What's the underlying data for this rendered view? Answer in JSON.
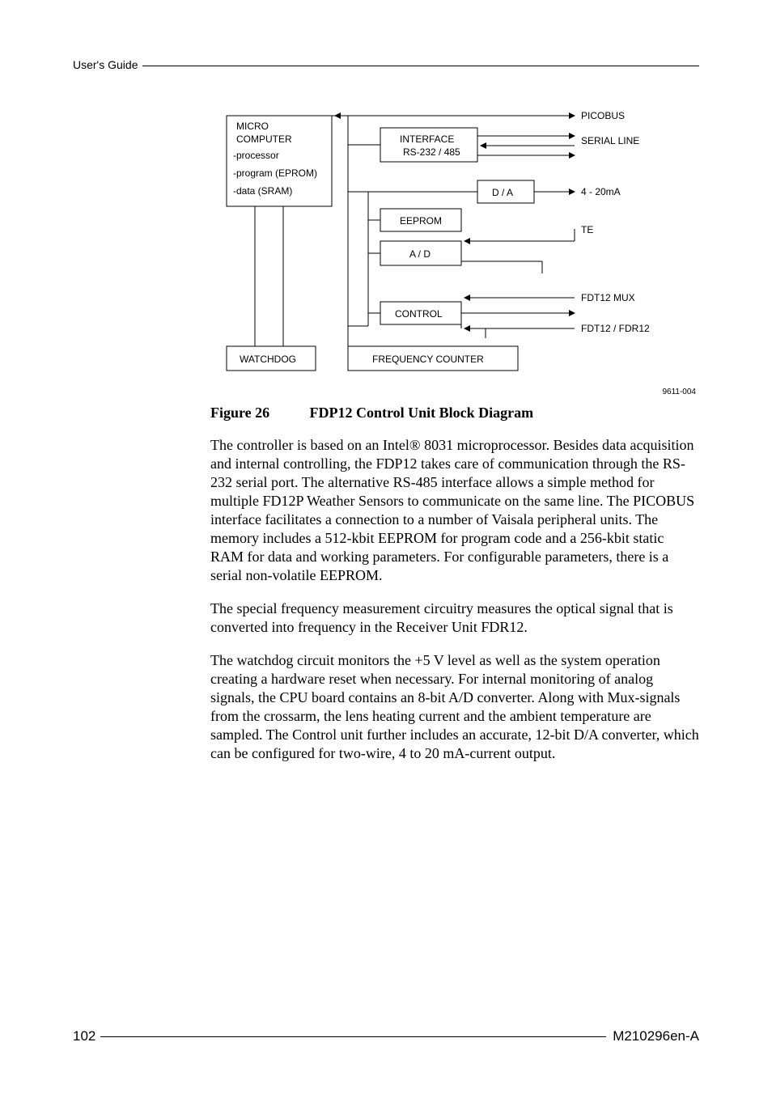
{
  "header": {
    "label": "User's Guide"
  },
  "diagram": {
    "code": "9611-004",
    "blocks": {
      "micro": {
        "title": "MICRO",
        "line2": "COMPUTER",
        "line3": "-processor",
        "line4": "-program (EPROM)",
        "line5": "-data (SRAM)"
      },
      "interface": {
        "title": "INTERFACE",
        "line2": "RS-232 / 485"
      },
      "da": "D / A",
      "eeprom": "EEPROM",
      "ad": "A / D",
      "control": "CONTROL",
      "watchdog": "WATCHDOG",
      "freq": "FREQUENCY COUNTER"
    },
    "labels": {
      "picobus": "PICOBUS",
      "serial": "SERIAL LINE",
      "am": "4 - 20mA",
      "te": "TE",
      "mux": "FDT12 MUX",
      "fdt": "FDT12 /  FDR12"
    }
  },
  "figure": {
    "label": "Figure 26",
    "title": "FDP12 Control Unit Block Diagram"
  },
  "paragraphs": {
    "p1": "The controller is based on an Intel® 8031 microprocessor. Besides data acquisition and internal controlling, the FDP12 takes care of communication through the RS-232 serial port. The alternative RS-485 interface allows a simple method for multiple FD12P Weather Sensors to communicate on the same line. The PICOBUS interface facilitates a connection to a number of Vaisala peripheral units. The memory includes a 512-kbit EEPROM for program code and a 256-kbit static RAM for data and working parameters. For configurable parameters, there is a serial non-volatile EEPROM.",
    "p2": "The special frequency measurement circuitry measures the optical signal that is converted into frequency in the Receiver Unit FDR12.",
    "p3": "The watchdog circuit monitors the +5 V level as well as the system operation creating a hardware reset when necessary. For internal monitoring of analog signals, the CPU board contains an 8-bit A/D converter. Along with Mux-signals from the crossarm, the lens heating current and the ambient temperature are sampled. The Control unit further includes an accurate, 12-bit D/A converter, which can be configured for two-wire, 4 to 20 mA-current output."
  },
  "footer": {
    "page": "102",
    "doc": "M210296en-A"
  }
}
